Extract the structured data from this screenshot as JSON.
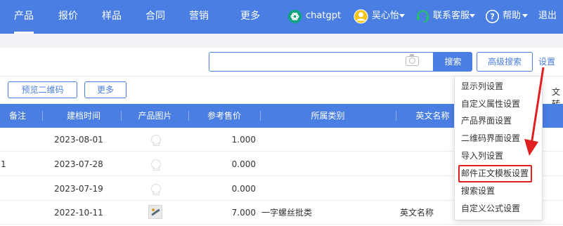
{
  "nav": {
    "tabs": [
      "产品",
      "报价",
      "样品",
      "合同",
      "营销",
      "更多"
    ],
    "chatgpt_label": "chatgpt",
    "user_name": "吴心怡",
    "support_label": "联系客服",
    "help_label": "帮助",
    "logout_label": "退出",
    "active_tab": "产品"
  },
  "search": {
    "value": "",
    "placeholder": "",
    "search_button": "搜索",
    "advanced_button": "高级搜索",
    "settings_link": "设置"
  },
  "toolbar": {
    "preview_qr": "预览二维码",
    "more": "更多",
    "cut_text": "文转"
  },
  "table": {
    "headers": [
      "备注",
      "建档时间",
      "产品图片",
      "参考售价",
      "所属类别",
      "英文名称"
    ],
    "rows": [
      {
        "remark": "",
        "date": "2023-08-01",
        "image": "placeholder",
        "price": "1.000",
        "category": "",
        "english_name": ""
      },
      {
        "remark": "1",
        "date": "2023-07-28",
        "image": "placeholder",
        "price": "0.000",
        "category": "",
        "english_name": ""
      },
      {
        "remark": "",
        "date": "2023-07-19",
        "image": "placeholder",
        "price": "0.000",
        "category": "",
        "english_name": ""
      },
      {
        "remark": "",
        "date": "2022-10-11",
        "image": "thumbnail",
        "price": "7.000",
        "category": "一字螺丝批类",
        "english_name": "英文名称"
      }
    ]
  },
  "settings_menu": {
    "items": [
      "显示列设置",
      "自定义属性设置",
      "产品界面设置",
      "二维码界面设置",
      "导入列设置",
      "邮件正文模板设置",
      "搜索设置",
      "自定义公式设置"
    ],
    "highlighted_item": "邮件正文模板设置"
  },
  "colors": {
    "brand": "#4a7ee3",
    "highlight": "#e02020",
    "chatgpt_icon": "#10a37f",
    "user_icon": "#f5c518",
    "support_icon": "#22c55e"
  },
  "icons": {
    "camera": "camera-icon",
    "chatgpt": "openai-icon",
    "user": "user-avatar-icon",
    "support": "headset-icon",
    "help": "help-circle-icon"
  }
}
